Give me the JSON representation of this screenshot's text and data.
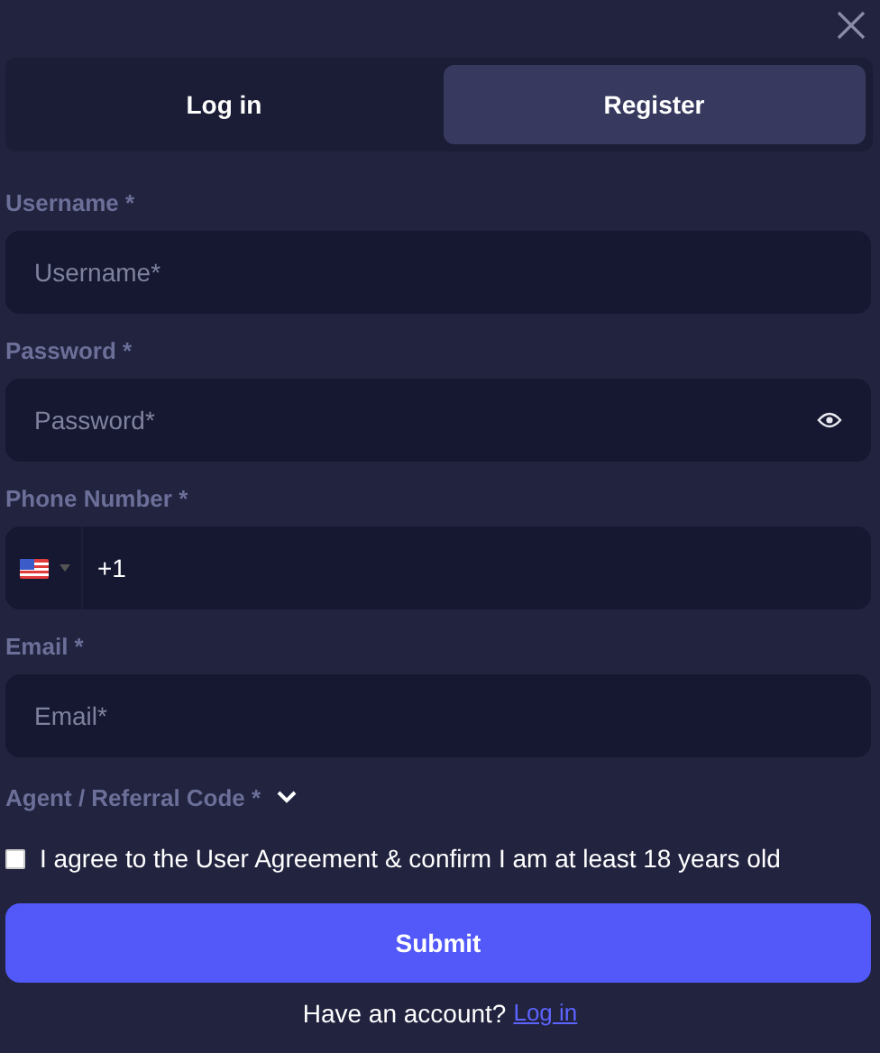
{
  "tabs": [
    {
      "label": "Log in",
      "selected": false
    },
    {
      "label": "Register",
      "selected": true
    }
  ],
  "fields": [
    {
      "kind": "text",
      "label": "Username *",
      "placeholder": "Username*"
    },
    {
      "kind": "password",
      "label": "Password *",
      "placeholder": "Password*"
    },
    {
      "kind": "phone",
      "label": "Phone Number *",
      "value": "+1"
    },
    {
      "kind": "text",
      "label": "Email *",
      "placeholder": "Email*"
    }
  ],
  "referral": {
    "label": "Agent / Referral Code *",
    "expanded": false
  },
  "agreement": {
    "text": "I agree to the User Agreement & confirm I am at least 18 years old",
    "checked": false
  },
  "submit": "Submit",
  "footer": {
    "text": "Have an account?",
    "link": "Log in"
  }
}
